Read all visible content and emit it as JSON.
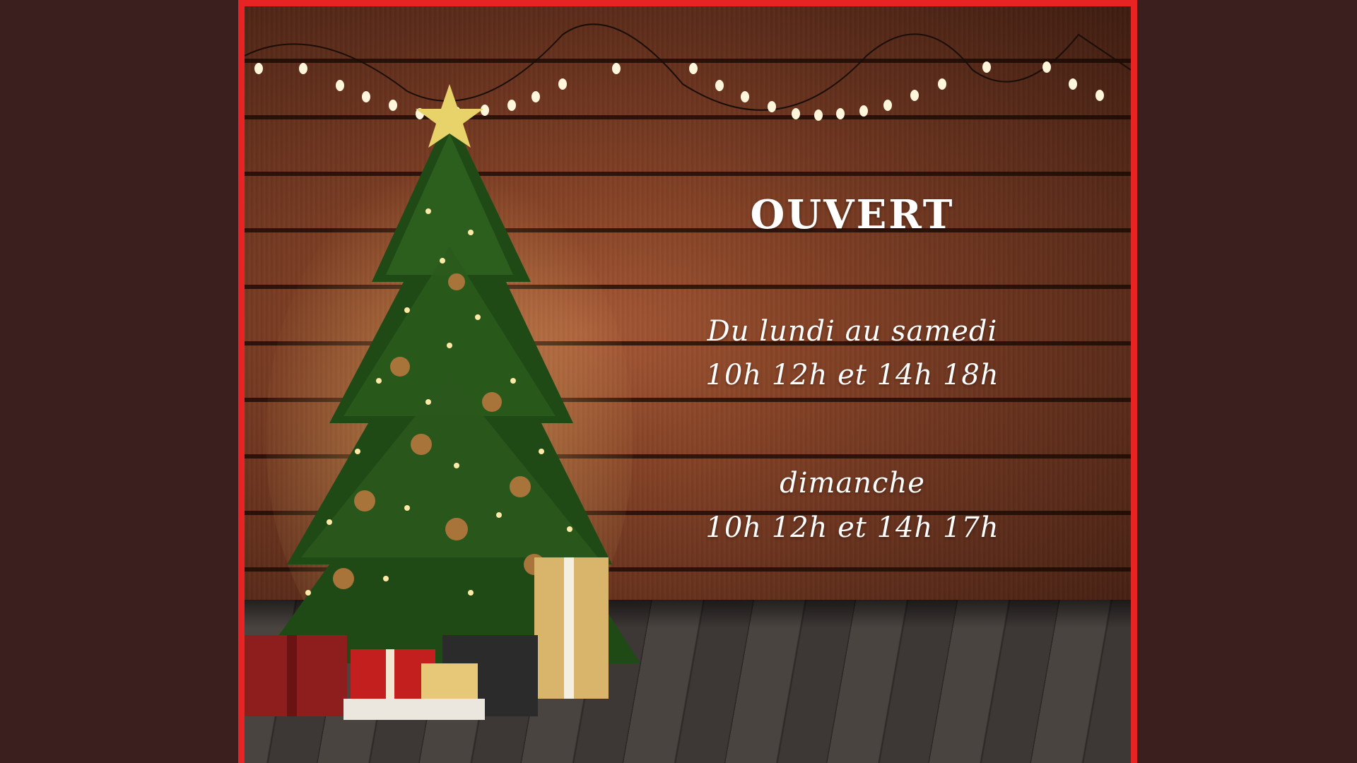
{
  "poster": {
    "title": "OUVERT",
    "weekday_label": "Du lundi au samedi",
    "weekday_hours": "10h 12h et 14h 18h",
    "sunday_label": "dimanche",
    "sunday_hours": "10h 12h et 14h 17h"
  },
  "colors": {
    "background": "#3a1f1e",
    "frame_border": "#e82323",
    "text": "#ffffff"
  },
  "icons": [
    "string-lights-icon",
    "christmas-tree-icon",
    "star-icon",
    "gift-box-icon"
  ]
}
